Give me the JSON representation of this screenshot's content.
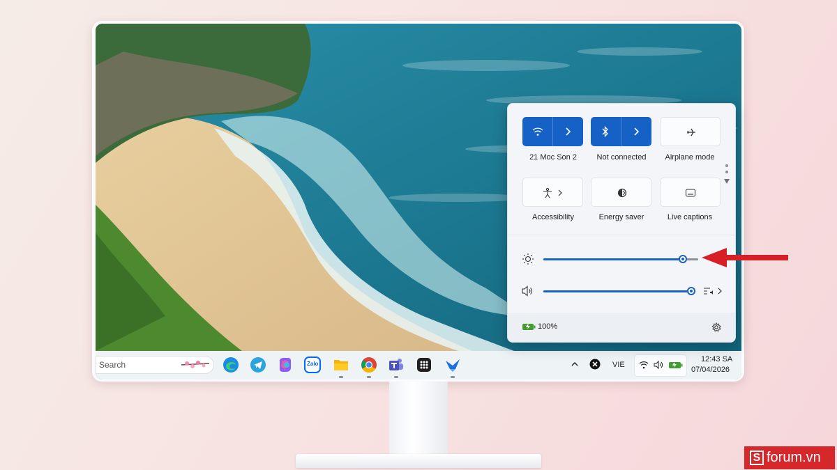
{
  "quick_settings": {
    "wifi": {
      "label": "21 Moc Son 2",
      "icon": "wifi-icon",
      "state": "on"
    },
    "bluetooth": {
      "label": "Not connected",
      "icon": "bluetooth-icon",
      "state": "on"
    },
    "airplane": {
      "label": "Airplane mode",
      "icon": "airplane-icon",
      "state": "off"
    },
    "accessibility": {
      "label": "Accessibility",
      "icon": "accessibility-icon"
    },
    "energy_saver": {
      "label": "Energy saver",
      "icon": "energy-saver-icon"
    },
    "live_captions": {
      "label": "Live captions",
      "icon": "live-captions-icon"
    },
    "brightness_level": 0.9,
    "volume_level": 1.0,
    "battery": "100%"
  },
  "taskbar": {
    "search_placeholder": "Search",
    "apps": [
      "edge-icon",
      "telegram-icon",
      "copilot-icon",
      "zalo-icon",
      "file-explorer-icon",
      "chrome-icon",
      "teams-icon",
      "app-grid-icon",
      "bluesky-icon"
    ],
    "zalo_text": "Zalo",
    "language": "VIE",
    "time": "12:43 SA",
    "date": "07/04/2026"
  },
  "watermark": {
    "brand_letter": "S",
    "text": "forum.vn"
  },
  "colors": {
    "accent": "#1661c6",
    "arrow": "#d61f26",
    "watermark_bg": "#d6282b"
  }
}
